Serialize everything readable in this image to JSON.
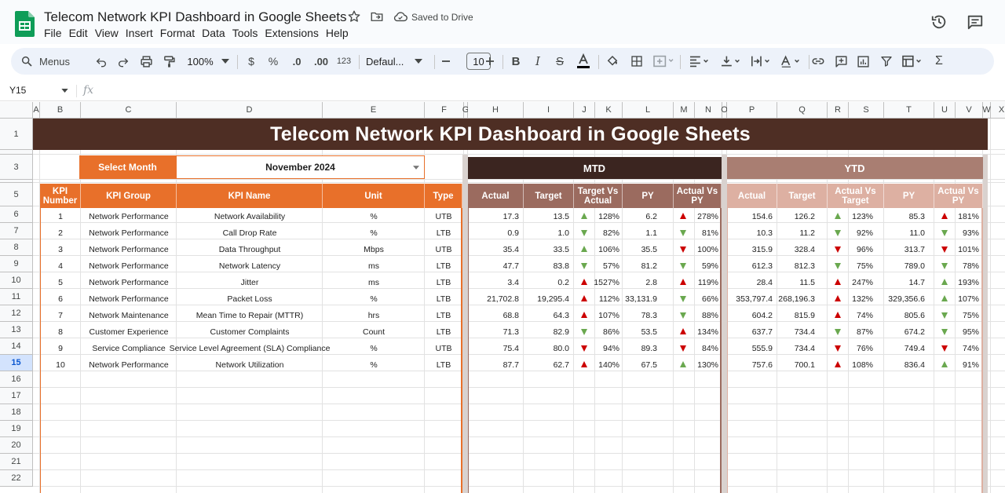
{
  "doc": {
    "title": "Telecom Network KPI Dashboard in Google Sheets",
    "saved_status": "Saved to Drive"
  },
  "menus": [
    "File",
    "Edit",
    "View",
    "Insert",
    "Format",
    "Data",
    "Tools",
    "Extensions",
    "Help"
  ],
  "toolbar": {
    "search_label": "Menus",
    "zoom": "100%",
    "currency": "$",
    "percent": "%",
    "dec_decrease": ".0",
    "dec_increase": ".00",
    "number_format": "123",
    "font": "Defaul...",
    "font_size": "10"
  },
  "formula_bar": {
    "cell_ref": "Y15",
    "fx": "fx"
  },
  "columns": [
    "A",
    "B",
    "C",
    "D",
    "E",
    "F",
    "G",
    "H",
    "I",
    "J",
    "K",
    "L",
    "M",
    "N",
    "O",
    "P",
    "Q",
    "R",
    "S",
    "T",
    "U",
    "V",
    "W",
    "X"
  ],
  "rows": [
    "1",
    "2",
    "3",
    "4",
    "5",
    "6",
    "7",
    "8",
    "9",
    "10",
    "11",
    "12",
    "13",
    "14",
    "15",
    "16",
    "17",
    "18",
    "19",
    "20",
    "21",
    "22"
  ],
  "selected_row": "15",
  "dashboard": {
    "banner": "Telecom Network KPI Dashboard in Google Sheets",
    "select_month_label": "Select Month",
    "select_month_value": "November 2024",
    "mtd_label": "MTD",
    "ytd_label": "YTD",
    "headers_left": [
      "KPI Number",
      "KPI Group",
      "KPI Name",
      "Unit",
      "Type"
    ],
    "headers_mtd": [
      "Actual",
      "Target",
      "Target Vs Actual",
      "PY",
      "Actual Vs PY"
    ],
    "headers_ytd": [
      "Actual",
      "Target",
      "Actual Vs Target",
      "PY",
      "Actual Vs PY"
    ],
    "colors": {
      "banner": "#4e2e24",
      "orange": "#e8702a",
      "mtd_band": "#3b2520",
      "mtd_header": "#9b6b5f",
      "ytd_band": "#a97e72",
      "ytd_header": "#ddb0a2",
      "arrow_up": "#6aa84f",
      "arrow_down": "#cc0000"
    },
    "kpis": [
      {
        "num": "1",
        "group": "Network Performance",
        "name": "Network Availability",
        "unit": "%",
        "type": "UTB",
        "mtd": {
          "actual": "17.3",
          "target": "13.5",
          "tva": "128%",
          "tva_dir": "up",
          "tva_color": "green",
          "py": "6.2",
          "avp": "278%",
          "avp_dir": "up",
          "avp_color": "red"
        },
        "ytd": {
          "actual": "154.6",
          "target": "126.2",
          "avt": "123%",
          "avt_dir": "up",
          "avt_color": "green",
          "py": "85.3",
          "avp": "181%",
          "avp_dir": "up",
          "avp_color": "red"
        }
      },
      {
        "num": "2",
        "group": "Network Performance",
        "name": "Call Drop Rate",
        "unit": "%",
        "type": "LTB",
        "mtd": {
          "actual": "0.9",
          "target": "1.0",
          "tva": "82%",
          "tva_dir": "down",
          "tva_color": "green",
          "py": "1.1",
          "avp": "81%",
          "avp_dir": "down",
          "avp_color": "green"
        },
        "ytd": {
          "actual": "10.3",
          "target": "11.2",
          "avt": "92%",
          "avt_dir": "down",
          "avt_color": "green",
          "py": "11.0",
          "avp": "93%",
          "avp_dir": "down",
          "avp_color": "green"
        }
      },
      {
        "num": "3",
        "group": "Network Performance",
        "name": "Data Throughput",
        "unit": "Mbps",
        "type": "UTB",
        "mtd": {
          "actual": "35.4",
          "target": "33.5",
          "tva": "106%",
          "tva_dir": "up",
          "tva_color": "green",
          "py": "35.5",
          "avp": "100%",
          "avp_dir": "down",
          "avp_color": "red"
        },
        "ytd": {
          "actual": "315.9",
          "target": "328.4",
          "avt": "96%",
          "avt_dir": "down",
          "avt_color": "red",
          "py": "313.7",
          "avp": "101%",
          "avp_dir": "down",
          "avp_color": "red"
        }
      },
      {
        "num": "4",
        "group": "Network Performance",
        "name": "Network Latency",
        "unit": "ms",
        "type": "LTB",
        "mtd": {
          "actual": "47.7",
          "target": "83.8",
          "tva": "57%",
          "tva_dir": "down",
          "tva_color": "green",
          "py": "81.2",
          "avp": "59%",
          "avp_dir": "down",
          "avp_color": "green"
        },
        "ytd": {
          "actual": "612.3",
          "target": "812.3",
          "avt": "75%",
          "avt_dir": "down",
          "avt_color": "green",
          "py": "789.0",
          "avp": "78%",
          "avp_dir": "down",
          "avp_color": "green"
        }
      },
      {
        "num": "5",
        "group": "Network Performance",
        "name": "Jitter",
        "unit": "ms",
        "type": "LTB",
        "mtd": {
          "actual": "3.4",
          "target": "0.2",
          "tva": "1527%",
          "tva_dir": "up",
          "tva_color": "red",
          "py": "2.8",
          "avp": "119%",
          "avp_dir": "up",
          "avp_color": "red"
        },
        "ytd": {
          "actual": "28.4",
          "target": "11.5",
          "avt": "247%",
          "avt_dir": "up",
          "avt_color": "red",
          "py": "14.7",
          "avp": "193%",
          "avp_dir": "up",
          "avp_color": "green"
        }
      },
      {
        "num": "6",
        "group": "Network Performance",
        "name": "Packet Loss",
        "unit": "%",
        "type": "LTB",
        "mtd": {
          "actual": "21,702.8",
          "target": "19,295.4",
          "tva": "112%",
          "tva_dir": "up",
          "tva_color": "red",
          "py": "33,131.9",
          "avp": "66%",
          "avp_dir": "down",
          "avp_color": "green"
        },
        "ytd": {
          "actual": "353,797.4",
          "target": "268,196.3",
          "avt": "132%",
          "avt_dir": "up",
          "avt_color": "red",
          "py": "329,356.6",
          "avp": "107%",
          "avp_dir": "up",
          "avp_color": "green"
        }
      },
      {
        "num": "7",
        "group": "Network Maintenance",
        "name": "Mean Time to Repair (MTTR)",
        "unit": "hrs",
        "type": "LTB",
        "mtd": {
          "actual": "68.8",
          "target": "64.3",
          "tva": "107%",
          "tva_dir": "up",
          "tva_color": "red",
          "py": "78.3",
          "avp": "88%",
          "avp_dir": "down",
          "avp_color": "green"
        },
        "ytd": {
          "actual": "604.2",
          "target": "815.9",
          "avt": "74%",
          "avt_dir": "up",
          "avt_color": "red",
          "py": "805.6",
          "avp": "75%",
          "avp_dir": "down",
          "avp_color": "green"
        }
      },
      {
        "num": "8",
        "group": "Customer Experience",
        "name": "Customer Complaints",
        "unit": "Count",
        "type": "LTB",
        "mtd": {
          "actual": "71.3",
          "target": "82.9",
          "tva": "86%",
          "tva_dir": "down",
          "tva_color": "green",
          "py": "53.5",
          "avp": "134%",
          "avp_dir": "up",
          "avp_color": "red"
        },
        "ytd": {
          "actual": "637.7",
          "target": "734.4",
          "avt": "87%",
          "avt_dir": "down",
          "avt_color": "green",
          "py": "674.2",
          "avp": "95%",
          "avp_dir": "down",
          "avp_color": "green"
        }
      },
      {
        "num": "9",
        "group": "Service Compliance",
        "name": "Service Level Agreement (SLA) Compliance",
        "unit": "%",
        "type": "UTB",
        "mtd": {
          "actual": "75.4",
          "target": "80.0",
          "tva": "94%",
          "tva_dir": "down",
          "tva_color": "red",
          "py": "89.3",
          "avp": "84%",
          "avp_dir": "down",
          "avp_color": "red"
        },
        "ytd": {
          "actual": "555.9",
          "target": "734.4",
          "avt": "76%",
          "avt_dir": "down",
          "avt_color": "red",
          "py": "749.4",
          "avp": "74%",
          "avp_dir": "down",
          "avp_color": "red"
        }
      },
      {
        "num": "10",
        "group": "Network Performance",
        "name": "Network Utilization",
        "unit": "%",
        "type": "LTB",
        "mtd": {
          "actual": "87.7",
          "target": "62.7",
          "tva": "140%",
          "tva_dir": "up",
          "tva_color": "red",
          "py": "67.5",
          "avp": "130%",
          "avp_dir": "up",
          "avp_color": "green"
        },
        "ytd": {
          "actual": "757.6",
          "target": "700.1",
          "avt": "108%",
          "avt_dir": "up",
          "avt_color": "red",
          "py": "836.4",
          "avp": "91%",
          "avp_dir": "up",
          "avp_color": "green"
        }
      }
    ]
  }
}
